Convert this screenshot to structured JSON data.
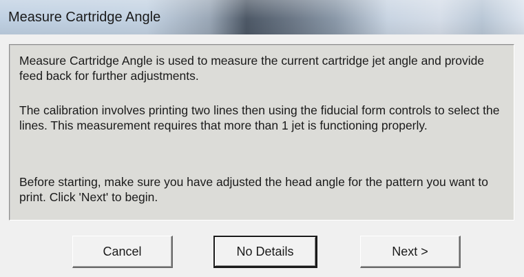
{
  "window": {
    "title": "Measure Cartridge Angle"
  },
  "info": {
    "paragraph1": "Measure Cartridge Angle is used to measure the current cartridge jet angle and provide feed back for further adjustments.",
    "paragraph2": "The calibration involves printing two lines then using the fiducial form controls to select the lines. This measurement requires that more than 1 jet is functioning properly.",
    "paragraph3": "Before starting, make sure you have adjusted the head angle for the pattern you want to print. Click 'Next' to begin."
  },
  "buttons": {
    "cancel": "Cancel",
    "details": "No Details",
    "next": "Next >"
  }
}
